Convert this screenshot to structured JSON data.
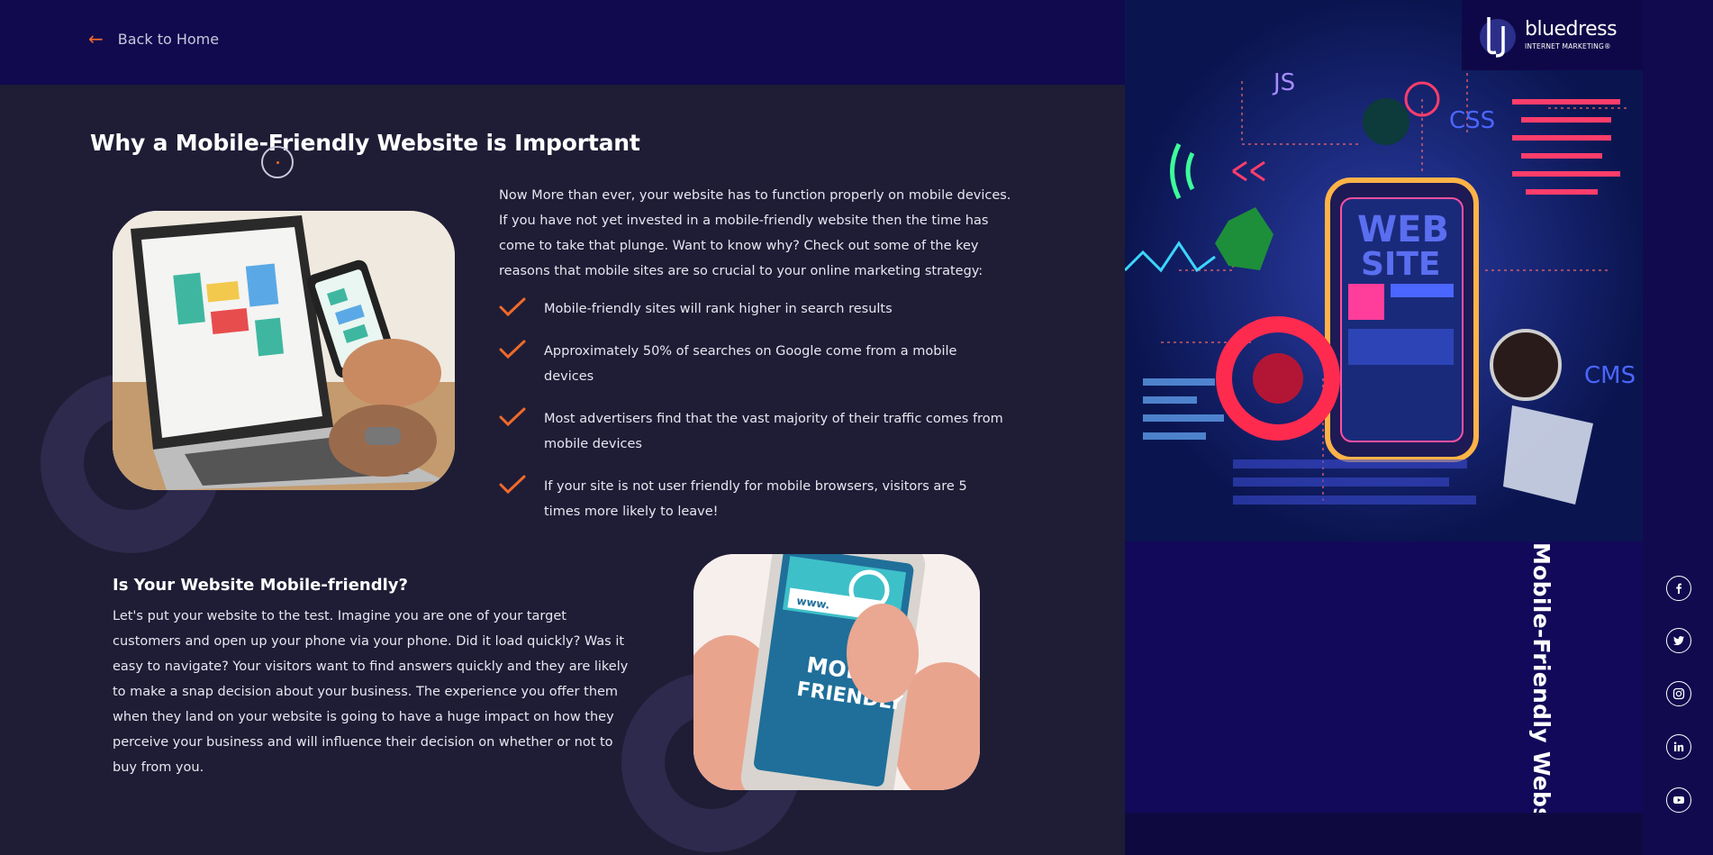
{
  "nav": {
    "back_label": "Back to Home"
  },
  "article": {
    "title": "Why a Mobile-Friendly Website is Important",
    "intro": "Now More than ever, your website has to function properly on mobile devices. If you have not yet invested in a mobile-friendly website then the time has come to take that plunge. Want to know why? Check out some of the key reasons that mobile sites are so crucial to your online marketing strategy:",
    "bullets": [
      "Mobile-friendly sites will rank higher in search results",
      "Approximately 50% of searches on Google come from a mobile devices",
      "Most advertisers find that the vast majority of their traffic comes from mobile devices",
      "If your site is not user friendly for mobile browsers, visitors are 5 times more likely to leave!"
    ],
    "subheading": "Is Your Website Mobile-friendly?",
    "sub_text": "Let's put your website to the test. Imagine you are one of your target customers and open up your phone via your phone. Did it load quickly? Was it easy to navigate? Your visitors want to find answers quickly and they are likely to make a snap decision about your business. The experience you offer them when they land on your website is going to have a huge impact on how they perceive your business and will influence their decision on whether or not to buy from you."
  },
  "images": {
    "phone_screen_text_1": "www.",
    "phone_screen_text_2": "MOBILE",
    "phone_screen_text_3": "FRIENDLY"
  },
  "hero": {
    "screen_text_1": "WEB",
    "screen_text_2": "SITE",
    "label_js": "JS",
    "label_css": "CSS",
    "label_cms": "CMS"
  },
  "brand": {
    "name": "bluedress",
    "tagline": "INTERNET MARKETING®"
  },
  "side_title": "Mobile-Friendly Website",
  "social": [
    "facebook-icon",
    "twitter-icon",
    "instagram-icon",
    "linkedin-icon",
    "youtube-icon"
  ],
  "colors": {
    "accent": "#f06a2a",
    "navy": "#110a4f",
    "background": "#1f1d35",
    "ring": "#2d2a4d"
  }
}
